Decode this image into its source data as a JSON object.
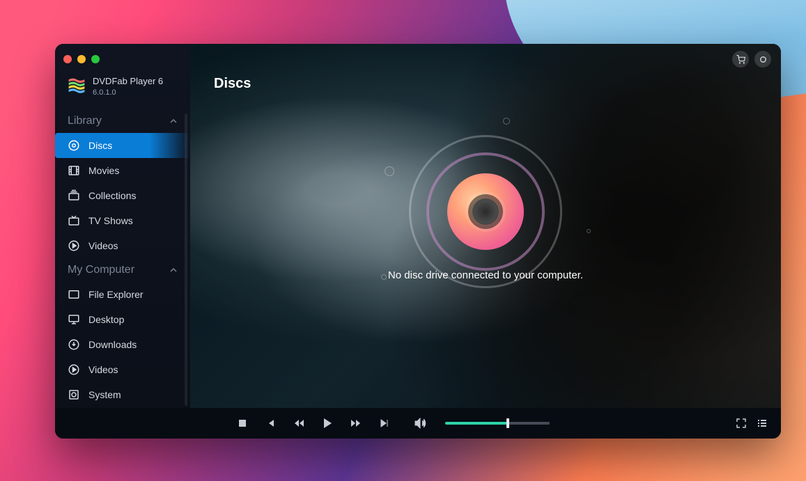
{
  "app": {
    "name": "DVDFab Player 6",
    "version": "6.0.1.0"
  },
  "sidebar": {
    "sections": [
      {
        "label": "Library",
        "expanded": true,
        "items": [
          {
            "icon": "disc-icon",
            "label": "Discs",
            "active": true
          },
          {
            "icon": "movie-icon",
            "label": "Movies"
          },
          {
            "icon": "collections-icon",
            "label": "Collections"
          },
          {
            "icon": "tv-icon",
            "label": "TV Shows"
          },
          {
            "icon": "video-icon",
            "label": "Videos"
          }
        ]
      },
      {
        "label": "My Computer",
        "expanded": true,
        "items": [
          {
            "icon": "folder-icon",
            "label": "File Explorer"
          },
          {
            "icon": "desktop-icon",
            "label": "Desktop"
          },
          {
            "icon": "download-icon",
            "label": "Downloads"
          },
          {
            "icon": "video-icon",
            "label": "Videos"
          },
          {
            "icon": "system-icon",
            "label": "System"
          }
        ]
      }
    ]
  },
  "main": {
    "title": "Discs",
    "status": "No disc drive connected to your computer."
  },
  "player": {
    "volume_pct": 60
  }
}
